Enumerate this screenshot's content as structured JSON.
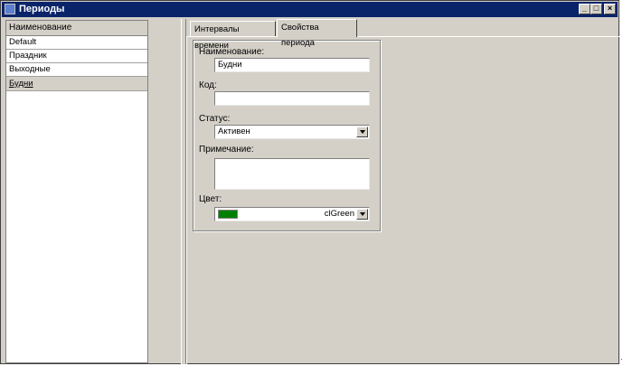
{
  "window": {
    "title": "Периоды",
    "buttons": [
      "_",
      "□",
      "×"
    ]
  },
  "list": {
    "header": "Наименование",
    "items": [
      "Default",
      "Праздник",
      "Выходные",
      "Будни"
    ],
    "selected": "Будни"
  },
  "tabs": [
    {
      "label": "Интервалы времени",
      "active": false
    },
    {
      "label": "Свойства периода",
      "active": true
    }
  ],
  "form": {
    "name_label": "Наименование:",
    "name_value": "Будни",
    "code_label": "Код:",
    "code_value": "",
    "status_label": "Статус:",
    "status_value": "Активен",
    "note_label": "Примечание:",
    "note_value": "",
    "color_label": "Цвет:",
    "color_value": "clGreen",
    "color_swatch": "#008000"
  },
  "icons": {
    "app": "window-icon",
    "dropdown": "chevron-down-icon"
  }
}
